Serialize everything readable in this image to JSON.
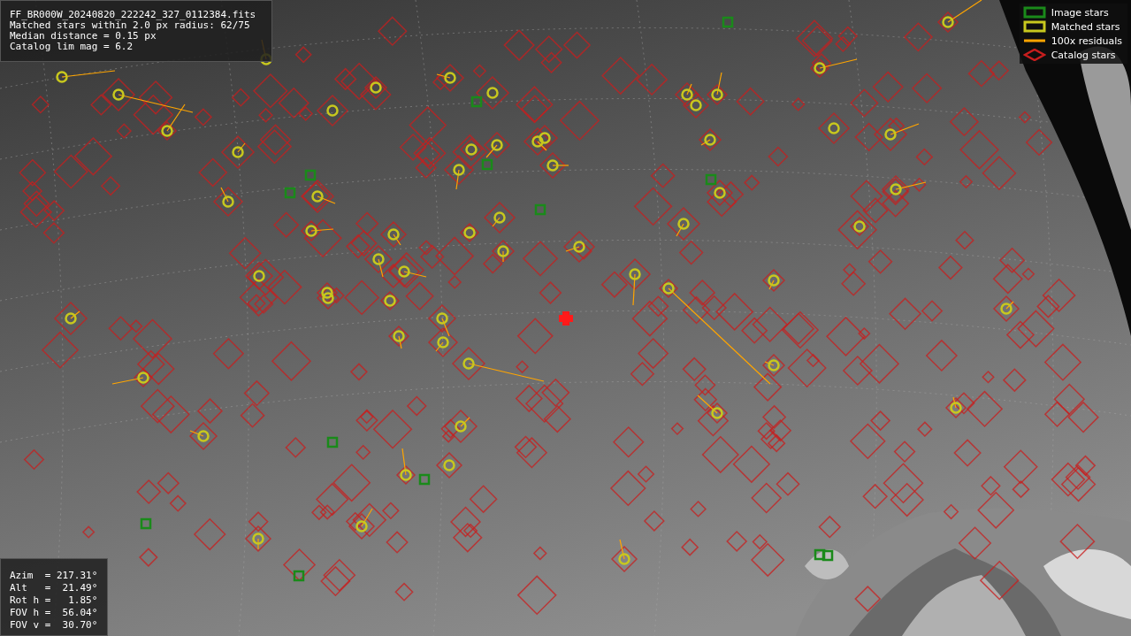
{
  "info_panel": {
    "lines": [
      "FF_BR000W_20240820_222242_327_0112384.fits",
      "Matched stars within 2.0 px radius: 62/75",
      "Median distance = 0.15 px",
      "Catalog lim mag = 6.2"
    ]
  },
  "legend": {
    "items": [
      {
        "kind": "box",
        "label": "Image stars",
        "color": "#1a8a1a"
      },
      {
        "kind": "box",
        "label": "Matched stars",
        "color": "#c8c81e"
      },
      {
        "kind": "line",
        "label": "100x residuals",
        "color": "#ffa500"
      },
      {
        "kind": "diamond",
        "label": "Catalog stars",
        "color": "#c81e1e"
      }
    ]
  },
  "pointing_panel": {
    "lines": [
      "Azim  = 217.31°",
      "Alt   =  21.49°",
      "Rot h =   1.85°",
      "FOV h =  56.04°",
      "FOV v =  30.70°"
    ]
  }
}
